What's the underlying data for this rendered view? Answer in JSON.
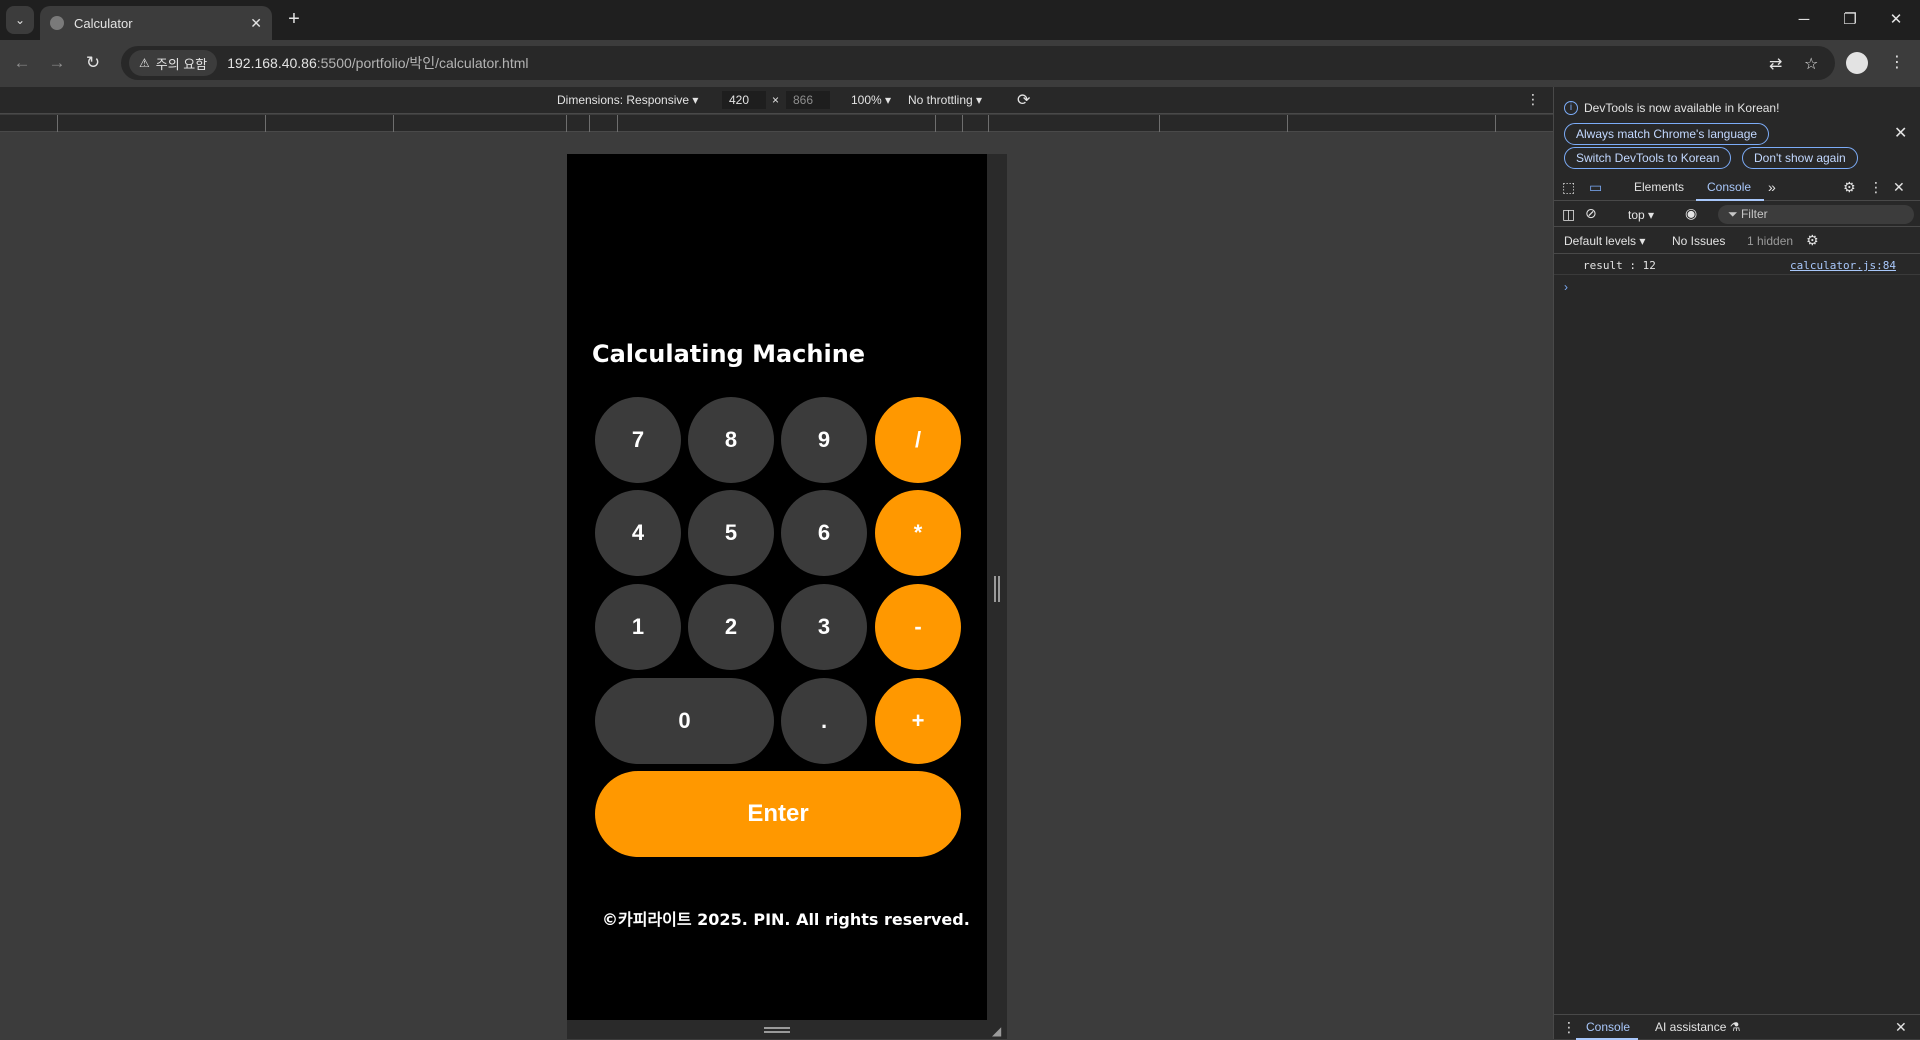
{
  "browser": {
    "tab_title": "Calculator",
    "security_chip": "주의 요함",
    "url_host": "192.168.40.86",
    "url_path": ":5500/portfolio/박인/calculator.html"
  },
  "device_toolbar": {
    "dimensions_label": "Dimensions: Responsive",
    "width": "420",
    "height": "866",
    "zoom": "100%",
    "throttling": "No throttling"
  },
  "page": {
    "title": "Calculating Machine",
    "keys": {
      "k7": "7",
      "k8": "8",
      "k9": "9",
      "div": "/",
      "k4": "4",
      "k5": "5",
      "k6": "6",
      "mul": "*",
      "k1": "1",
      "k2": "2",
      "k3": "3",
      "sub": "-",
      "k0": "0",
      "dot": ".",
      "add": "+"
    },
    "enter": "Enter",
    "copyright": "©카피라이트 2025. PIN. All rights reserved."
  },
  "devtools": {
    "info_message": "DevTools is now available in Korean!",
    "btn_match_language": "Always match Chrome's language",
    "btn_switch_korean": "Switch DevTools to Korean",
    "btn_dont_show": "Don't show again",
    "tabs": {
      "elements": "Elements",
      "console": "Console"
    },
    "context": "top",
    "filter_placeholder": "Filter",
    "levels": "Default levels",
    "issues": "No Issues",
    "hidden": "1 hidden",
    "log_message": "result : 12",
    "log_source": "calculator.js:84",
    "drawer": {
      "console": "Console",
      "ai": "AI assistance"
    }
  },
  "colors": {
    "accent_orange": "#ff9800",
    "number_key": "#3b3b3b",
    "devtools_link": "#a8c7fa"
  }
}
